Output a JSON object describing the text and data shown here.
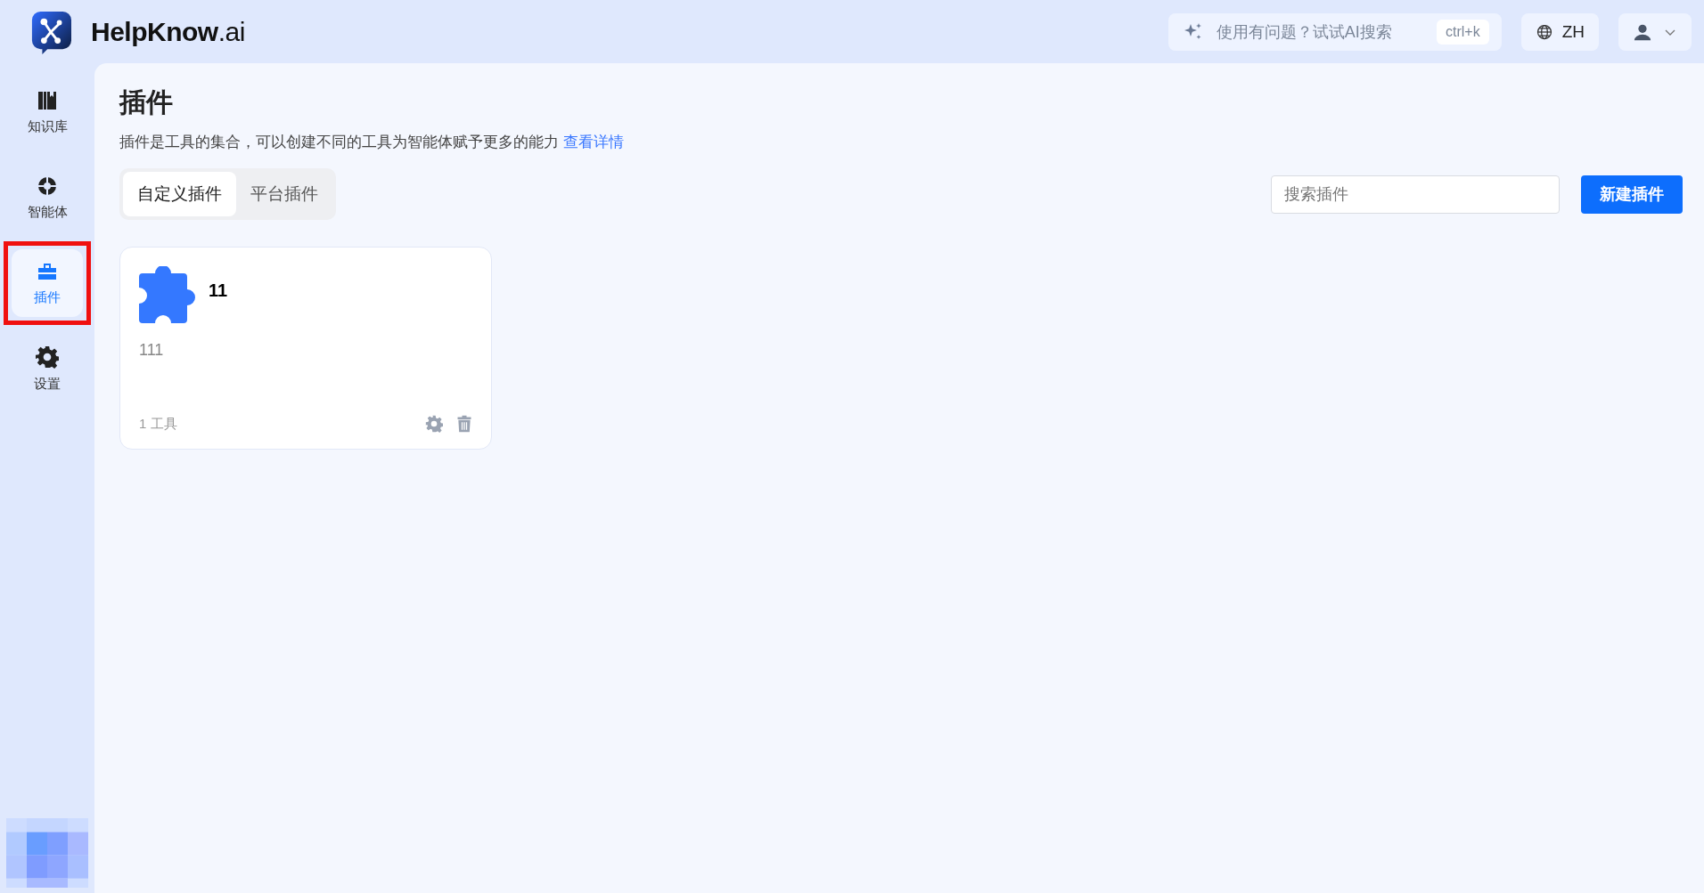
{
  "header": {
    "brand": "HelpKnow",
    "brand_suffix": ".ai",
    "ai_search": {
      "placeholder": "使用有问题？试试AI搜索",
      "shortcut": "ctrl+k"
    },
    "language": "ZH"
  },
  "sidebar": {
    "items": [
      {
        "kind": "library",
        "label": "知识库",
        "selected": false,
        "highlighted": false
      },
      {
        "kind": "agent",
        "label": "智能体",
        "selected": false,
        "highlighted": false
      },
      {
        "kind": "plugin",
        "label": "插件",
        "selected": true,
        "highlighted": true
      },
      {
        "kind": "settings",
        "label": "设置",
        "selected": false,
        "highlighted": false
      }
    ]
  },
  "page": {
    "title": "插件",
    "description": "插件是工具的集合，可以创建不同的工具为智能体赋予更多的能力",
    "details_link": "查看详情"
  },
  "tabs": [
    {
      "label": "自定义插件",
      "selected": true
    },
    {
      "label": "平台插件",
      "selected": false
    }
  ],
  "search": {
    "placeholder": "搜索插件"
  },
  "new_button": "新建插件",
  "plugins": [
    {
      "name": "11",
      "description": "111",
      "tools": "1 工具"
    }
  ]
}
